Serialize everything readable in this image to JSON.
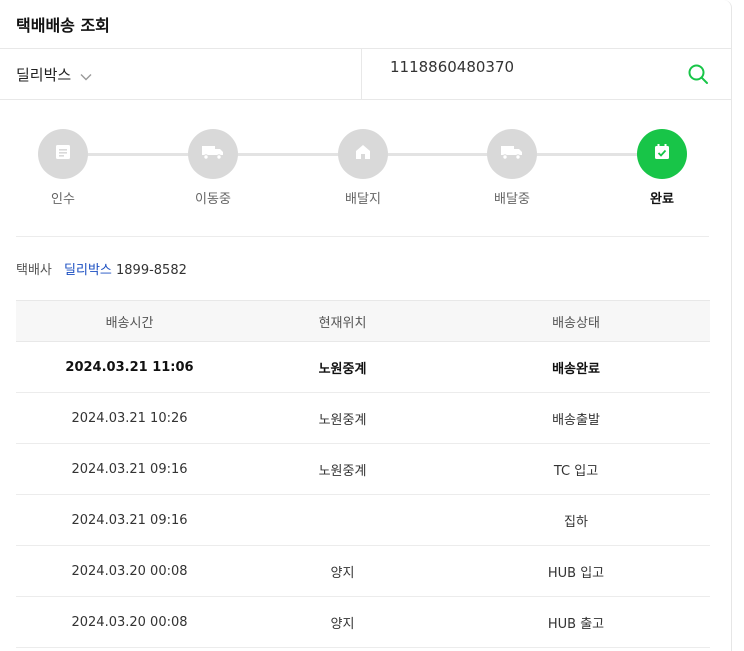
{
  "header": {
    "title": "택배배송 조회"
  },
  "search": {
    "carrier": "딜리박스",
    "tracking_value": "1118860480370"
  },
  "steps": [
    {
      "label": "인수",
      "icon": "receipt-icon",
      "done": false
    },
    {
      "label": "이동중",
      "icon": "truck-icon",
      "done": false
    },
    {
      "label": "배달지",
      "icon": "home-icon",
      "done": false
    },
    {
      "label": "배달중",
      "icon": "truck-icon",
      "done": false
    },
    {
      "label": "완료",
      "icon": "calendar-check-icon",
      "done": true
    }
  ],
  "company": {
    "label": "택배사",
    "name": "딜리박스",
    "phone": "1899-8582"
  },
  "table": {
    "headers": [
      "배송시간",
      "현재위치",
      "배송상태"
    ],
    "rows": [
      {
        "time": "2024.03.21 11:06",
        "location": "노원중계",
        "status": "배송완료"
      },
      {
        "time": "2024.03.21 10:26",
        "location": "노원중계",
        "status": "배송출발"
      },
      {
        "time": "2024.03.21 09:16",
        "location": "노원중계",
        "status": "TC 입고"
      },
      {
        "time": "2024.03.21 09:16",
        "location": "",
        "status": "집하"
      },
      {
        "time": "2024.03.20 00:08",
        "location": "양지",
        "status": "HUB 입고"
      },
      {
        "time": "2024.03.20 00:08",
        "location": "양지",
        "status": "HUB 출고"
      }
    ]
  },
  "colors": {
    "accent": "#18c548",
    "link": "#1a4ec1",
    "inactive": "#d9d9d9"
  }
}
